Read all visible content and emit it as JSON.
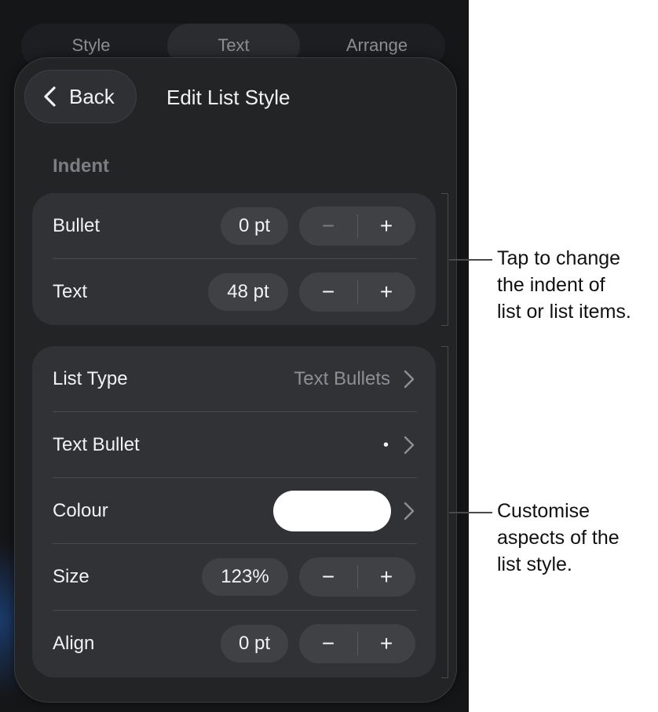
{
  "tabs": [
    {
      "label": "Style",
      "active": false
    },
    {
      "label": "Text",
      "active": true
    },
    {
      "label": "Arrange",
      "active": false
    }
  ],
  "header": {
    "back_label": "Back",
    "title": "Edit List Style"
  },
  "indent": {
    "section_label": "Indent",
    "rows": [
      {
        "label": "Bullet",
        "value": "0 pt",
        "minus_enabled": false
      },
      {
        "label": "Text",
        "value": "48 pt",
        "minus_enabled": true
      }
    ]
  },
  "style": {
    "list_type": {
      "label": "List Type",
      "value": "Text Bullets"
    },
    "text_bullet": {
      "label": "Text Bullet",
      "value": "•"
    },
    "colour": {
      "label": "Colour",
      "swatch": "#ffffff"
    },
    "size": {
      "label": "Size",
      "value": "123%"
    },
    "align": {
      "label": "Align",
      "value": "0 pt"
    }
  },
  "stepper": {
    "minus": "−",
    "plus": "+"
  },
  "callouts": {
    "indent_lines": [
      "Tap to change",
      "the indent of",
      "list or list items."
    ],
    "style_lines": [
      "Customise",
      "aspects of the",
      "list style."
    ]
  },
  "colors": {
    "background": "#151618",
    "panel": "#232426",
    "group": "#313235",
    "pill": "#404145"
  }
}
